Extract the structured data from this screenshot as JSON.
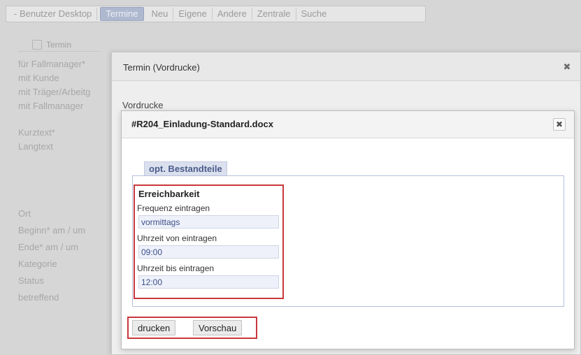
{
  "tabbar": {
    "items": [
      {
        "label": "- Benutzer Desktop"
      },
      {
        "label": "Termine",
        "active": true
      },
      {
        "label": "Neu"
      },
      {
        "label": "Eigene"
      },
      {
        "label": "Andere"
      },
      {
        "label": "Zentrale"
      },
      {
        "label": "Suche"
      }
    ]
  },
  "subtab": {
    "label": "Termin"
  },
  "bg_form": {
    "labels": [
      "für Fallmanager*",
      "mit Kunde",
      "mit Träger/Arbeitg",
      "mit Fallmanager",
      "Kurztext*",
      "Langtext",
      "Ort",
      "Beginn* am / um",
      "Ende* am / um",
      "Kategorie",
      "Status",
      "betreffend"
    ]
  },
  "outer_dialog": {
    "title": "Termin (Vordrucke)",
    "close": "✖",
    "subtitle": "Vordrucke"
  },
  "inner_dialog": {
    "title": "#R204_Einladung-Standard.docx",
    "close": "✖",
    "tab_label": "opt. Bestandteile",
    "group_title": "Erreichbarkeit",
    "fields": [
      {
        "label": "Frequenz eintragen",
        "value": "vormittags"
      },
      {
        "label": "Uhrzeit von eintragen",
        "value": "09:00"
      },
      {
        "label": "Uhrzeit bis eintragen",
        "value": "12:00"
      }
    ],
    "buttons": {
      "print": "drucken",
      "preview": "Vorschau"
    }
  },
  "colors": {
    "highlight_border": "#c9383d",
    "tab_accent": "#4b5c8c",
    "input_bg": "#eef1f9"
  }
}
